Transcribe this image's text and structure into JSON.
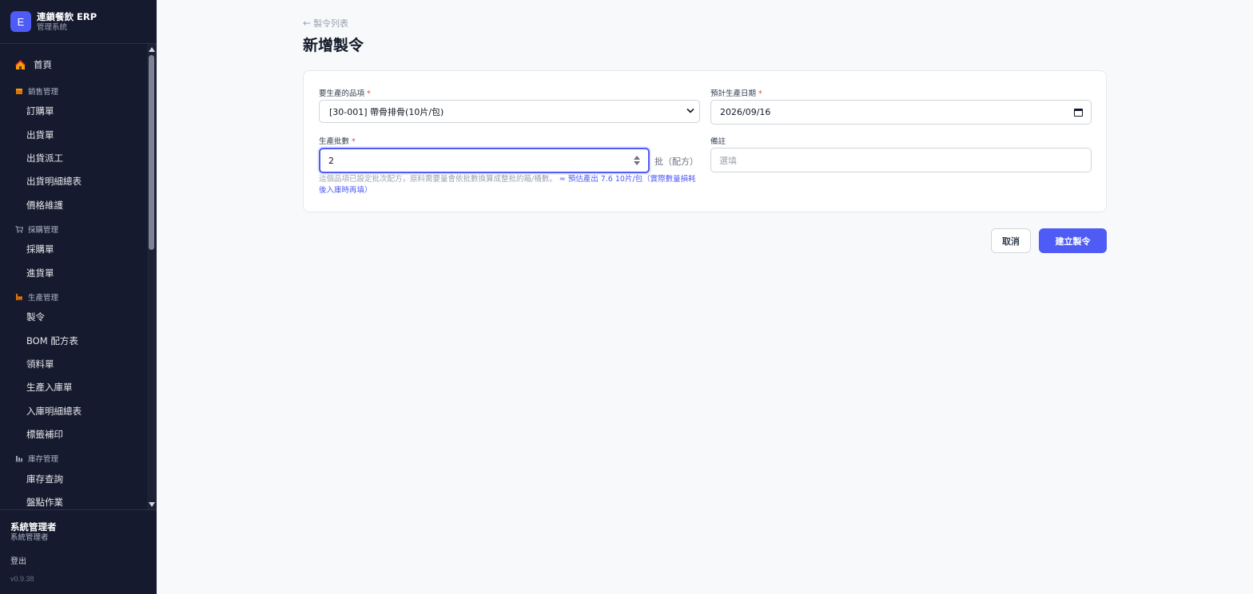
{
  "app": {
    "logo_letter": "E",
    "title": "連鎖餐飲 ERP",
    "subtitle": "管理系統"
  },
  "nav": {
    "home": {
      "label": "首頁",
      "icon": "home-icon"
    },
    "sales": {
      "group": "銷售管理",
      "icon": "box-icon",
      "items": [
        "訂購單",
        "出貨單",
        "出貨派工",
        "出貨明細總表",
        "價格維護"
      ]
    },
    "purchase": {
      "group": "採購管理",
      "icon": "cart-icon",
      "items": [
        "採購單",
        "進貨單"
      ]
    },
    "production": {
      "group": "生產管理",
      "icon": "factory-icon",
      "items": [
        "製令",
        "BOM 配方表",
        "領料單",
        "生產入庫單",
        "入庫明細總表",
        "標籤補印"
      ]
    },
    "inventory": {
      "group": "庫存管理",
      "icon": "warehouse-icon",
      "items": [
        "庫存查詢",
        "盤點作業"
      ]
    }
  },
  "footer": {
    "user_name": "系統管理者",
    "user_role": "系統管理者",
    "logout": "登出",
    "version": "v0.9.38"
  },
  "breadcrumb": {
    "label": "製令列表",
    "arrow": "←"
  },
  "page_title": "新增製令",
  "form": {
    "item": {
      "label": "要生產的品項",
      "required": "*",
      "value": "[30-001] 帶骨排骨(10片/包)"
    },
    "date": {
      "label": "預計生產日期",
      "required": "*",
      "value": "2026/09/16"
    },
    "batches": {
      "label": "生產批數",
      "required": "*",
      "value": "2",
      "unit": "批（配方）"
    },
    "note": {
      "label": "備註",
      "placeholder": "選填",
      "value": ""
    },
    "hint": "這個品項已設定批次配方，原料需要量會依批數換算成整批的箱/桶數。",
    "estimate": "≈ 預估產出 7.6 10片/包（實際數量損耗後入庫時再填）"
  },
  "buttons": {
    "cancel": "取消",
    "submit": "建立製令"
  },
  "colors": {
    "sidebar_bg": "#161a2e",
    "accent": "#4f5bf5",
    "required": "#ef4444"
  }
}
